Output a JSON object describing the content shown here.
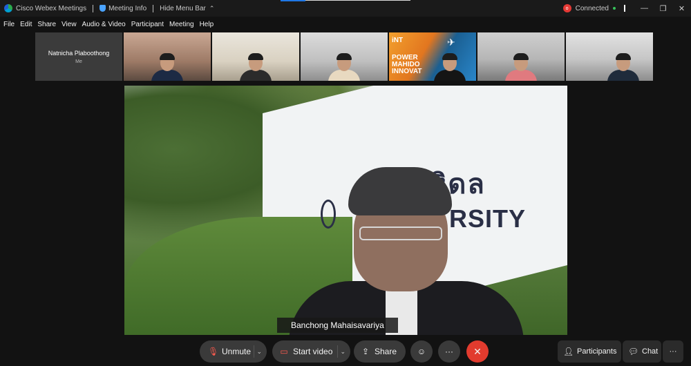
{
  "titlebar": {
    "app_name": "Cisco Webex Meetings",
    "meeting_info": "Meeting Info",
    "hide_menu": "Hide Menu Bar",
    "status": "Connected",
    "rec_glyph": "o",
    "status_color": "#37c25a",
    "accent_red": "#e53935"
  },
  "menu": [
    "File",
    "Edit",
    "Share",
    "View",
    "Audio & Video",
    "Participant",
    "Meeting",
    "Help"
  ],
  "thumbnails": {
    "self_name": "Natnicha Plaboothong",
    "self_tag": "Me",
    "poster_line1": "POWER",
    "poster_line2": "MAHIDO",
    "poster_line3": "INNOVAT",
    "poster_brand": "iNT"
  },
  "main": {
    "speaker_name": "Banchong Mahaisavariya",
    "sign_thai": "หิดล",
    "sign_en": "RSITY"
  },
  "controls": {
    "unmute": "Unmute",
    "start_video": "Start video",
    "share": "Share",
    "participants": "Participants",
    "chat": "Chat",
    "end_color": "#e23b2e"
  }
}
